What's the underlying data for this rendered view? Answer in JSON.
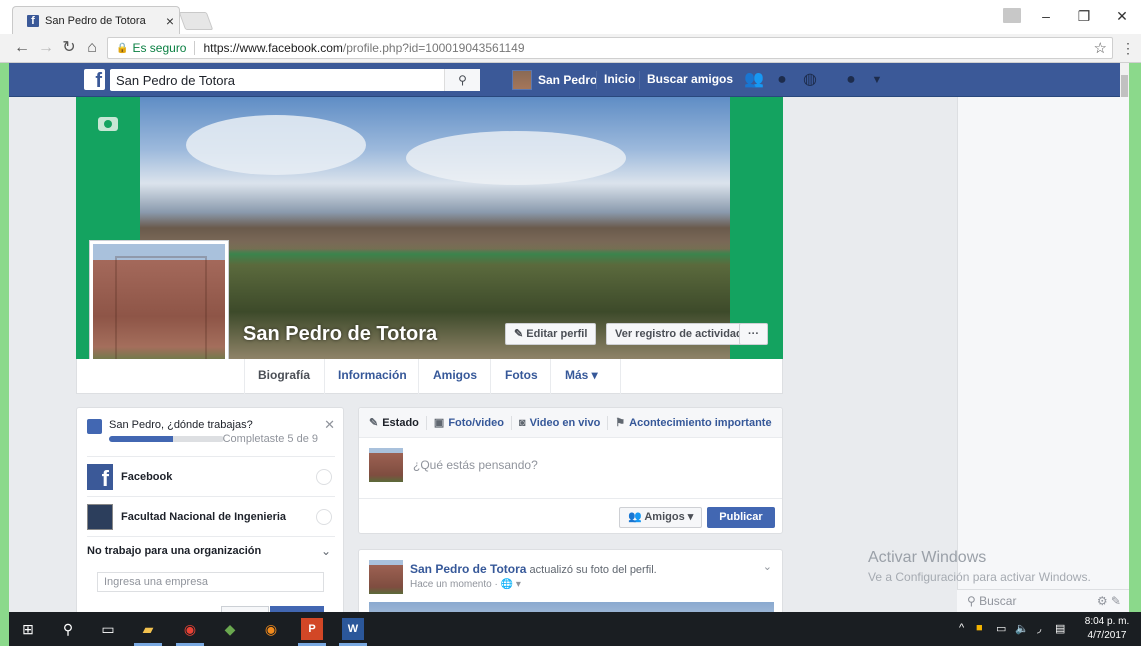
{
  "browser": {
    "tab_title": "San Pedro de Totora",
    "secure_label": "Es seguro",
    "url_host": "https://www.facebook.com",
    "url_rest": "/profile.php?id=100019043561149"
  },
  "fbbar": {
    "search_value": "San Pedro de Totora",
    "user_name": "San Pedro",
    "home_label": "Inicio",
    "find_friends_label": "Buscar amigos"
  },
  "profile": {
    "name": "San Pedro de Totora",
    "edit_profile": "Editar perfil",
    "activity_log": "Ver registro de actividad",
    "more_dots": "···",
    "tabs": [
      "Biografía",
      "Información",
      "Amigos",
      "Fotos",
      "Más ▾"
    ]
  },
  "work_card": {
    "question": "San Pedro, ¿dónde trabajas?",
    "progress_text": "Completaste 5 de 9",
    "progress": 0.5556,
    "items": [
      "Facebook",
      "Facultad Nacional de Ingenieria"
    ],
    "no_work": "No trabajo para una organización",
    "company_placeholder": "Ingresa una empresa"
  },
  "composer": {
    "actions": [
      "Estado",
      "Foto/video",
      "Video en vivo",
      "Acontecimiento importante"
    ],
    "placeholder": "¿Qué estás pensando?",
    "audience": "Amigos",
    "publish": "Publicar"
  },
  "post": {
    "author": "San Pedro de Totora",
    "action_text": "actualizó su foto del perfil.",
    "time": "Hace un momento · 🌐 ▾"
  },
  "watermark": {
    "line1": "Activar Windows",
    "line2": "Ve a Configuración para activar Windows."
  },
  "chat": {
    "search_placeholder": "Buscar"
  },
  "taskbar": {
    "time": "8:04 p. m.",
    "date": "4/7/2017"
  },
  "colors": {
    "fb_blue": "#3b5998",
    "cover_green": "#14a360",
    "button_blue": "#4267b2",
    "link": "#365899"
  }
}
